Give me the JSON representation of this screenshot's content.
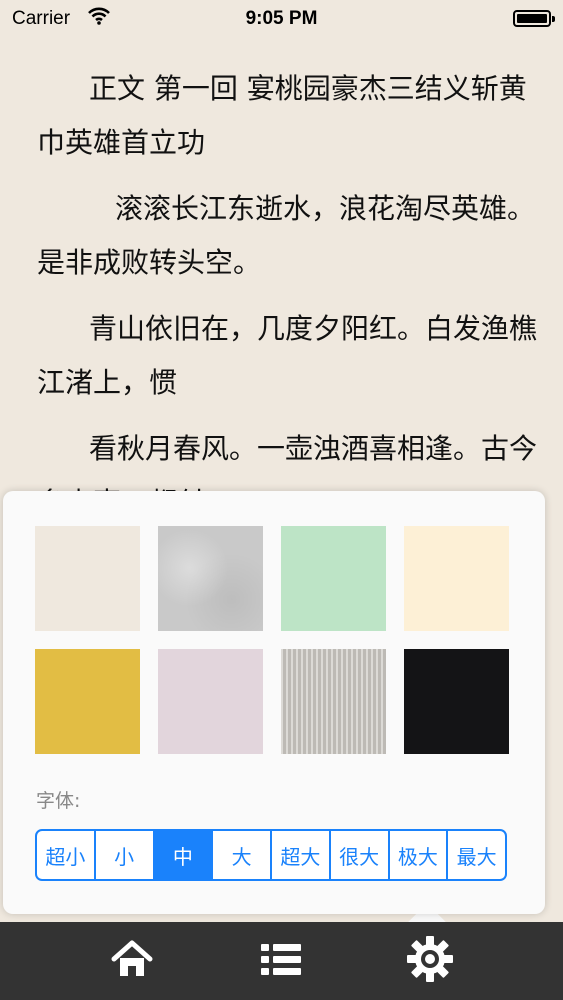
{
  "status": {
    "carrier": "Carrier",
    "time": "9:05 PM"
  },
  "reader": {
    "title": "正文 第一回 宴桃园豪杰三结义斩黄巾英雄首立功",
    "paragraphs": [
      "滚滚长江东逝水，浪花淘尽英雄。是非成败转头空。",
      "青山依旧在，几度夕阳红。白发渔樵江渚上，惯",
      "看秋月春风。一壶浊酒喜相逢。古今多少事，都付"
    ]
  },
  "settings": {
    "backgrounds": [
      {
        "color": "#efe8de",
        "pattern": "plain"
      },
      {
        "color": "#c9c9c9",
        "pattern": "marble"
      },
      {
        "color": "#bde4c6",
        "pattern": "plain"
      },
      {
        "color": "#fdf0d6",
        "pattern": "plain"
      },
      {
        "color": "#e2bd44",
        "pattern": "plain"
      },
      {
        "color": "#e2d5dc",
        "pattern": "plain"
      },
      {
        "color": "#c9c6c0",
        "pattern": "stripes"
      },
      {
        "color": "#141416",
        "pattern": "plain"
      }
    ],
    "font_label": "字体:",
    "font_sizes": [
      "超小",
      "小",
      "中",
      "大",
      "超大",
      "很大",
      "极大",
      "最大"
    ],
    "selected_font_size": "中",
    "accent_color": "#1a82fb"
  },
  "tabbar": {
    "items": [
      {
        "icon": "home-icon"
      },
      {
        "icon": "list-icon"
      },
      {
        "icon": "gear-icon"
      }
    ]
  }
}
